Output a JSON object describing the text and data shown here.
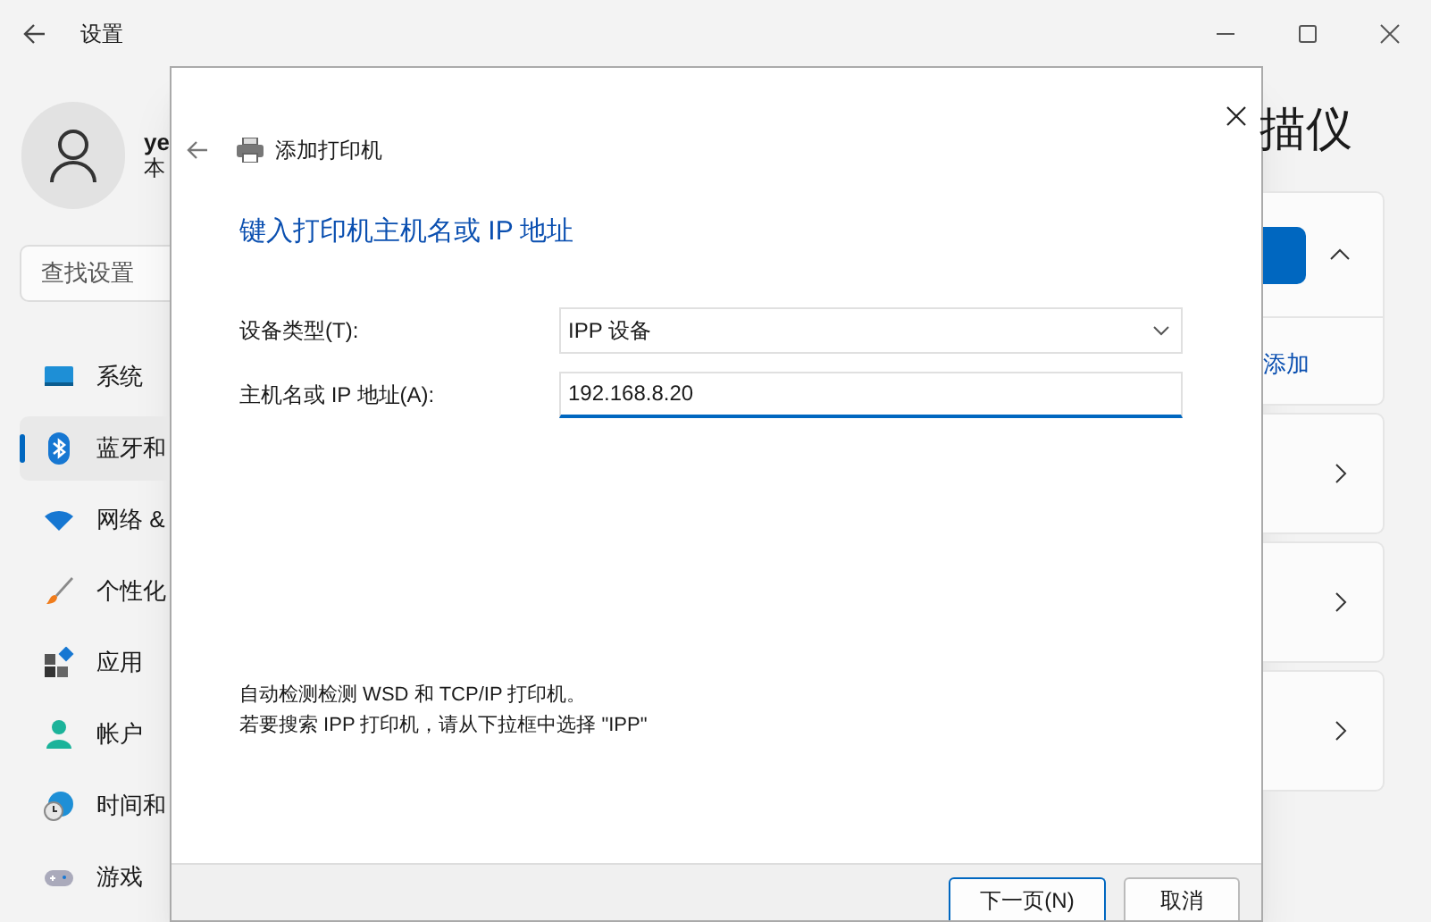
{
  "settings_window": {
    "title": "设置",
    "user": {
      "name": "ye",
      "subtitle": "本"
    },
    "search": {
      "placeholder": "查找设置"
    },
    "nav_items": [
      {
        "label": "系统",
        "kind": "system",
        "selected": false
      },
      {
        "label": "蓝牙和",
        "kind": "bluetooth",
        "selected": true
      },
      {
        "label": "网络 &",
        "kind": "network",
        "selected": false
      },
      {
        "label": "个性化",
        "kind": "brush",
        "selected": false
      },
      {
        "label": "应用",
        "kind": "apps",
        "selected": false
      },
      {
        "label": "帐户",
        "kind": "account",
        "selected": false
      },
      {
        "label": "时间和",
        "kind": "clock",
        "selected": false
      },
      {
        "label": "游戏",
        "kind": "game",
        "selected": false
      }
    ],
    "page_title": "描仪",
    "add_link": "添加"
  },
  "dialog": {
    "title": "添加打印机",
    "heading": "键入打印机主机名或 IP 地址",
    "fields": [
      {
        "kind": "select",
        "label": "设备类型(T):",
        "value": "IPP 设备"
      },
      {
        "kind": "input",
        "label": "主机名或 IP 地址(A):",
        "value": "192.168.8.20"
      }
    ],
    "notes": [
      "自动检测检测 WSD 和 TCP/IP 打印机。",
      "若要搜索 IPP 打印机，请从下拉框中选择 \"IPP\""
    ],
    "buttons": [
      {
        "label": "下一页(N)",
        "default": true
      },
      {
        "label": "取消",
        "default": false
      }
    ]
  }
}
